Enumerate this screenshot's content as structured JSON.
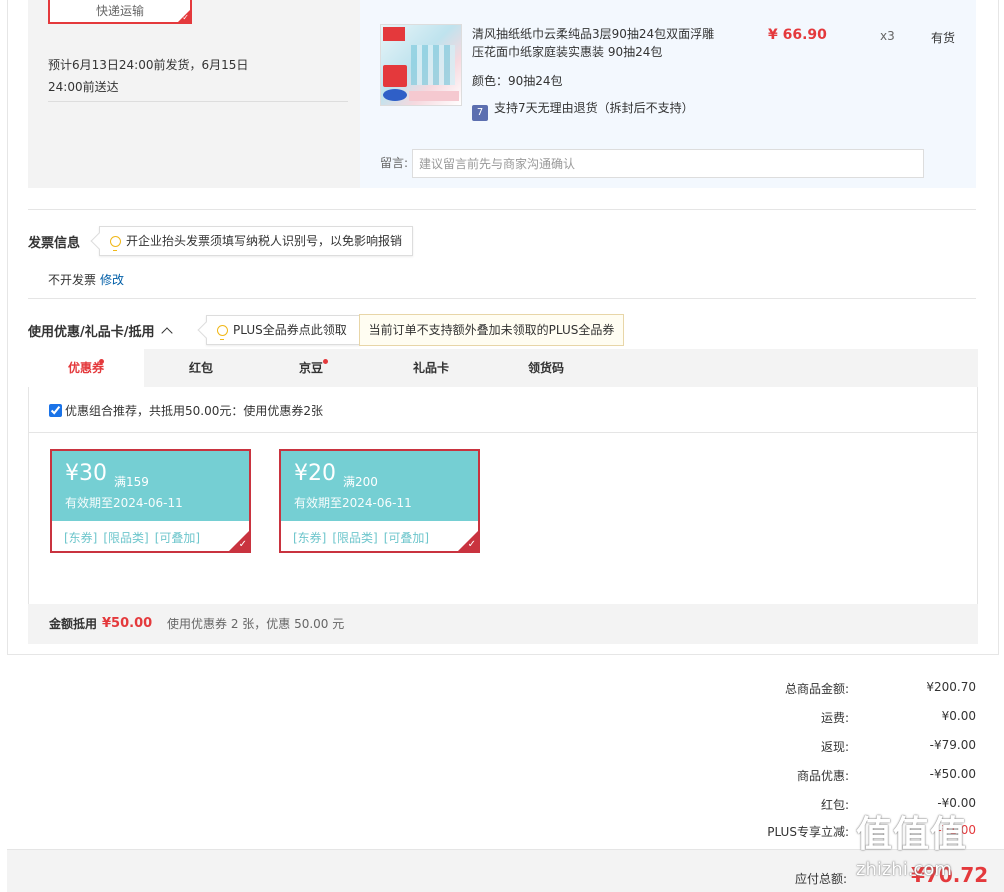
{
  "shipping": {
    "method_label": "快递运输",
    "estimate_line1": "预计6月13日24:00前发货，6月15日",
    "estimate_line2": "24:00前送达"
  },
  "product": {
    "title": "清风抽纸纸巾云柔纯品3层90抽24包双面浮雕压花面巾纸家庭装实惠装 90抽24包",
    "spec": "颜色：90抽24包",
    "return_badge": "7",
    "return_text": "支持7天无理由退货（拆封后不支持）",
    "price": "¥ 66.90",
    "quantity": "x3",
    "stock": "有货"
  },
  "message": {
    "label": "留言:",
    "placeholder": "建议留言前先与商家沟通确认"
  },
  "invoice": {
    "title": "发票信息",
    "tip": "开企业抬头发票须填写纳税人识别号，以免影响报销",
    "status": "不开发票",
    "edit_link": "修改"
  },
  "discount": {
    "title": "使用优惠/礼品卡/抵用",
    "plus_tip": "PLUS全品券点此领取",
    "warning": "当前订单不支持额外叠加未领取的PLUS全品券",
    "tabs": [
      {
        "label": "优惠券",
        "dot": true
      },
      {
        "label": "红包",
        "dot": false
      },
      {
        "label": "京豆",
        "dot": true
      },
      {
        "label": "礼品卡",
        "dot": false
      },
      {
        "label": "领货码",
        "dot": false
      }
    ],
    "combo_text": "优惠组合推荐，共抵用50.00元：使用优惠券2张",
    "coupons": [
      {
        "amount": "¥30",
        "condition": "满159",
        "valid": "有效期至2024-06-11",
        "tags": [
          "[东券]",
          "[限品类]",
          "[可叠加]"
        ]
      },
      {
        "amount": "¥20",
        "condition": "满200",
        "valid": "有效期至2024-06-11",
        "tags": [
          "[东券]",
          "[限品类]",
          "[可叠加]"
        ]
      }
    ],
    "deduct_label": "金额抵用",
    "deduct_value": "¥50.00",
    "deduct_desc": "使用优惠券 2 张，优惠 50.00 元"
  },
  "summary": {
    "rows": [
      {
        "label": "总商品金额:",
        "value": "¥200.70"
      },
      {
        "label": "运费:",
        "value": "¥0.00"
      },
      {
        "label": "返现:",
        "value": "-¥79.00"
      },
      {
        "label": "商品优惠:",
        "value": "-¥50.00"
      },
      {
        "label": "红包:",
        "value": "-¥0.00"
      },
      {
        "label": "PLUS专享立减:",
        "value": "-¥1.00"
      }
    ],
    "total_label": "应付总额:",
    "total_value": "¥70.72"
  },
  "watermark": {
    "logo": "值值值",
    "site": "zhizhi.com"
  },
  "colors": {
    "accent": "#e4393c",
    "coupon_bg": "#75cfd3",
    "link": "#005ea7"
  }
}
